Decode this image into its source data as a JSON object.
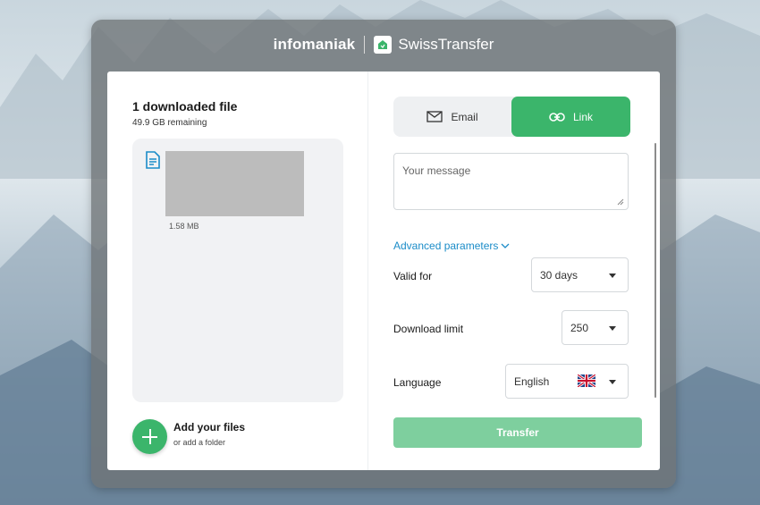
{
  "brand": {
    "company": "infomaniak",
    "product": "SwissTransfer"
  },
  "files": {
    "title": "1 downloaded file",
    "remaining": "49.9 GB remaining",
    "items": [
      {
        "size": "1.58 MB"
      }
    ],
    "add_title": "Add your files",
    "add_sub": "or add a folder"
  },
  "send": {
    "tabs": [
      {
        "label": "Email",
        "icon": "envelope-icon",
        "selected": false
      },
      {
        "label": "Link",
        "icon": "link-icon",
        "selected": true
      }
    ],
    "message_placeholder": "Your message",
    "advanced_label": "Advanced parameters",
    "valid_for": {
      "label": "Valid for",
      "value": "30 days"
    },
    "download_limit": {
      "label": "Download limit",
      "value": "250"
    },
    "language": {
      "label": "Language",
      "value": "English",
      "flag": "uk-flag-icon"
    },
    "transfer_label": "Transfer"
  },
  "colors": {
    "accent": "#3bb56b",
    "accent_disabled": "#7ecf9e",
    "link_blue": "#1b8cc8"
  }
}
